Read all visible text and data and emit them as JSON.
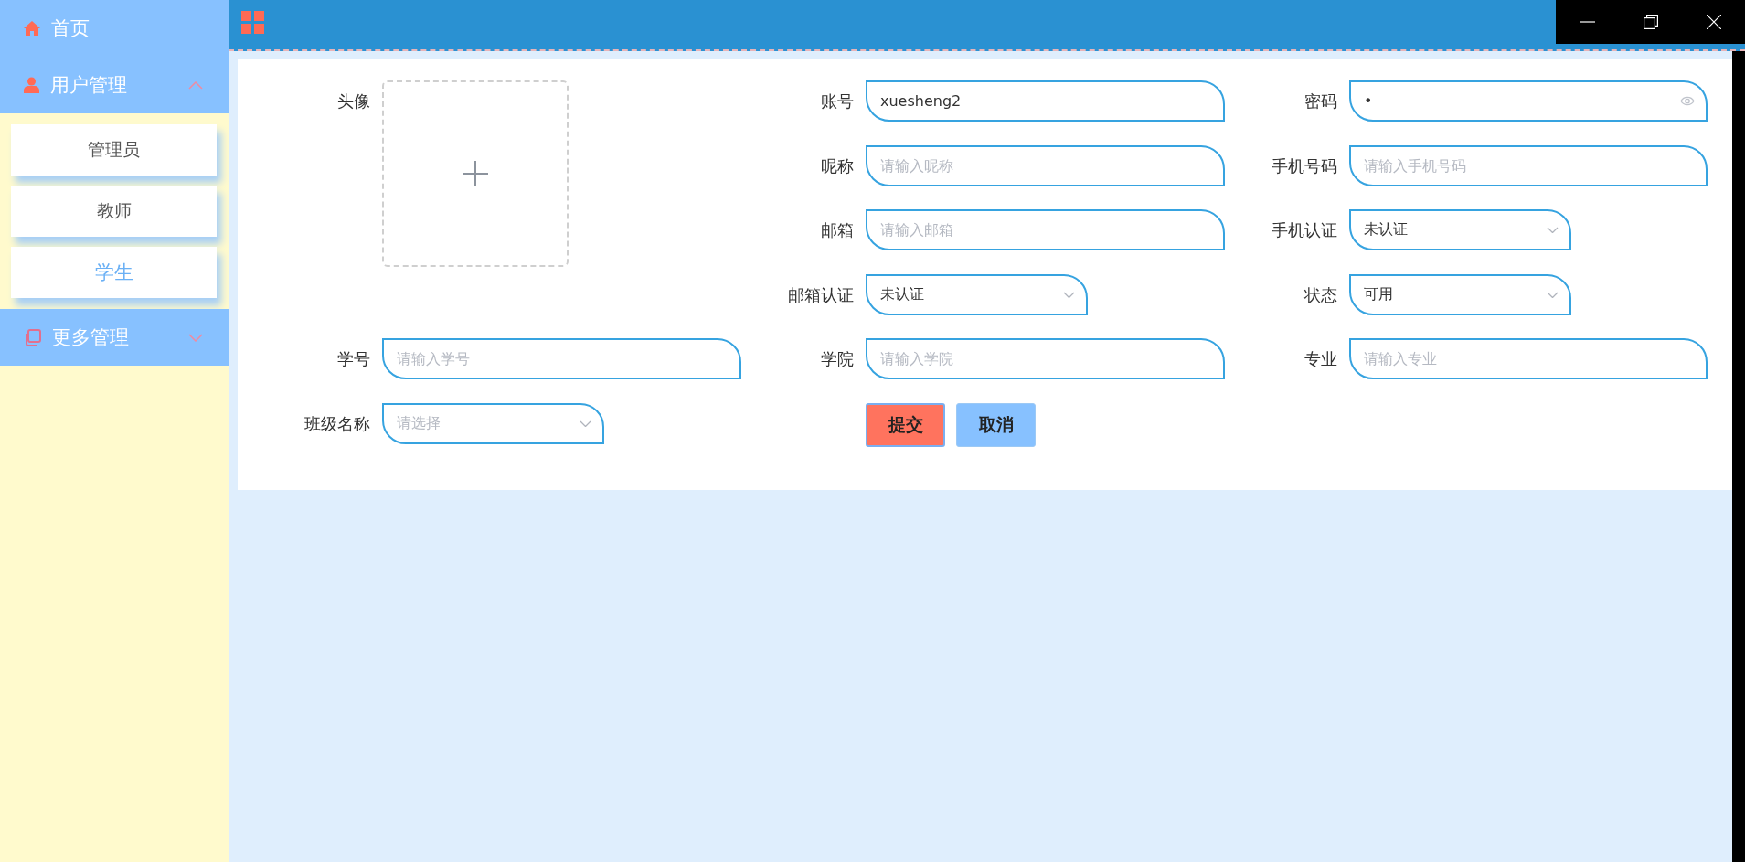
{
  "sidebar": {
    "items": [
      {
        "label": "首页"
      },
      {
        "label": "用户管理",
        "expanded": true,
        "children": [
          {
            "label": "管理员",
            "selected": false
          },
          {
            "label": "教师",
            "selected": false
          },
          {
            "label": "学生",
            "selected": true
          }
        ]
      },
      {
        "label": "更多管理",
        "expanded": false
      }
    ]
  },
  "form": {
    "columns": [
      [
        {
          "kind": "upload",
          "label": "头像"
        },
        {
          "kind": "input",
          "label": "学号",
          "placeholder": "请输入学号"
        },
        {
          "kind": "select",
          "label": "班级名称",
          "placeholder": "请选择"
        }
      ],
      [
        {
          "kind": "input",
          "label": "账号",
          "value": "xuesheng2"
        },
        {
          "kind": "input",
          "label": "昵称",
          "placeholder": "请输入昵称"
        },
        {
          "kind": "input",
          "label": "邮箱",
          "placeholder": "请输入邮箱"
        },
        {
          "kind": "select",
          "label": "邮箱认证",
          "value": "未认证"
        },
        {
          "kind": "input",
          "label": "学院",
          "placeholder": "请输入学院"
        },
        {
          "kind": "actions",
          "buttons": [
            {
              "label": "提交",
              "kind": "primary"
            },
            {
              "label": "取消",
              "kind": "secondary"
            }
          ]
        }
      ],
      [
        {
          "kind": "password",
          "label": "密码",
          "value": "•"
        },
        {
          "kind": "input",
          "label": "手机号码",
          "placeholder": "请输入手机号码"
        },
        {
          "kind": "select",
          "label": "手机认证",
          "value": "未认证"
        },
        {
          "kind": "select",
          "label": "状态",
          "value": "可用"
        },
        {
          "kind": "input",
          "label": "专业",
          "placeholder": "请输入专业"
        }
      ]
    ]
  }
}
